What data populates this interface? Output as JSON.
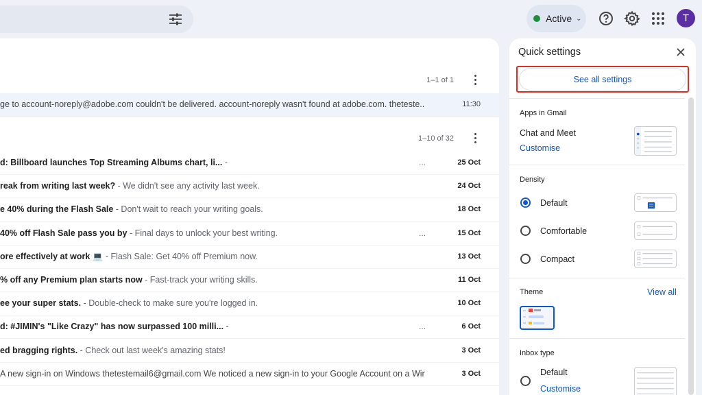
{
  "header": {
    "status_label": "Active",
    "avatar_letter": "T"
  },
  "mail": {
    "top_pager": "1–1 of 1",
    "highlighted_row": {
      "text": "ge to account-noreply@adobe.com couldn't be delivered. account-noreply wasn't found at adobe.com. thetestе...",
      "time": "11:30"
    },
    "list_pager": "1–10 of 32",
    "rows": [
      {
        "subject": "d: Billboard launches Top Streaming Albums chart, li...",
        "snippet": " -",
        "dots": "...",
        "date": "25 Oct"
      },
      {
        "subject": "reak from writing last week?",
        "snippet": " - We didn't see any activity last week.",
        "dots": "",
        "date": "24 Oct"
      },
      {
        "subject": "e 40% during the Flash Sale",
        "snippet": " - Don't wait to reach your writing goals.",
        "dots": "",
        "date": "18 Oct"
      },
      {
        "subject": "40% off Flash Sale pass you by",
        "snippet": " - Final days to unlock your best writing.",
        "dots": "...",
        "date": "15 Oct"
      },
      {
        "subject": "ore effectively at work 💻",
        "snippet": " - Flash Sale: Get 40% off Premium now.",
        "dots": "",
        "date": "13 Oct"
      },
      {
        "subject": "% off any Premium plan starts now",
        "snippet": " - Fast-track your writing skills.",
        "dots": "",
        "date": "11 Oct"
      },
      {
        "subject": "ee your super stats.",
        "snippet": " - Double-check to make sure you're logged in.",
        "dots": "",
        "date": "10 Oct"
      },
      {
        "subject": "d: #JIMIN's \"Like Crazy\" has now surpassed 100 milli...",
        "snippet": " -",
        "dots": "...",
        "date": "6 Oct"
      },
      {
        "subject": "ed bragging rights.",
        "snippet": " - Check out last week's amazing stats!",
        "dots": "",
        "date": "3 Oct"
      },
      {
        "subject": "",
        "snippet": "A new sign-in on Windows thetestemail6@gmail.com We noticed a new sign-in to your Google Account on a Windo...",
        "dots": "",
        "date": "3 Oct",
        "read": true
      }
    ]
  },
  "quick_settings": {
    "title": "Quick settings",
    "see_all": "See all settings",
    "apps_header": "Apps in Gmail",
    "apps_item": "Chat and Meet",
    "apps_link": "Customise",
    "density_header": "Density",
    "density_options": [
      "Default",
      "Comfortable",
      "Compact"
    ],
    "density_selected": "Default",
    "theme_header": "Theme",
    "theme_link": "View all",
    "inbox_header": "Inbox type",
    "inbox_option": "Default",
    "inbox_link": "Customise"
  },
  "colors": {
    "accent": "#0b57d0",
    "highlight_border": "#d93025",
    "status_green": "#1e8e3e",
    "avatar": "#5b2ea6"
  },
  "icons": [
    "filter-icon",
    "help-icon",
    "gear-icon",
    "apps-grid-icon",
    "close-icon",
    "more-vert-icon"
  ]
}
